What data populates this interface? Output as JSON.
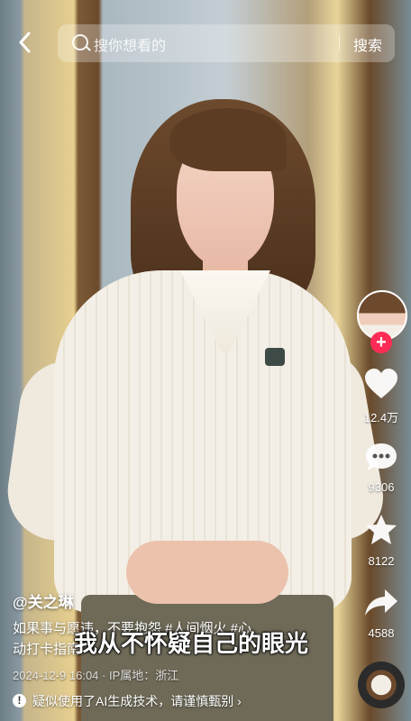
{
  "search": {
    "back_icon": "chevron-left-icon",
    "placeholder": "搜你想看的",
    "button_label": "搜索"
  },
  "rail": {
    "follow_symbol": "+",
    "likes": "12.4万",
    "comments": "9306",
    "favorites": "8122",
    "shares": "4588"
  },
  "video": {
    "author": "@关之琳",
    "description_line1": "如果事与愿违，不要抱怨 #人间烟火  #心",
    "description_line2": "动打卡指南",
    "subtitle": "我从不怀疑自己的眼光",
    "meta": "2024-12-9 16:04 · IP属地：浙江"
  },
  "warning": {
    "icon_symbol": "!",
    "text": "疑似使用了AI生成技术，请谨慎甄别 ›"
  },
  "colors": {
    "follow": "#fe2c55",
    "text": "#ffffff"
  }
}
